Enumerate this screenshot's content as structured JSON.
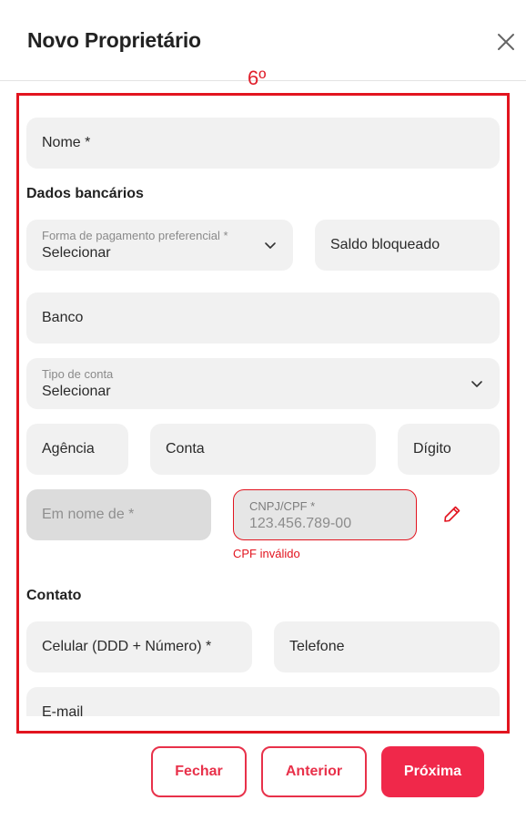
{
  "header": {
    "title": "Novo Proprietário"
  },
  "step": {
    "label": "6º"
  },
  "form": {
    "nome": {
      "placeholder": "Nome *"
    },
    "dados_bancarios": {
      "heading": "Dados bancários",
      "forma_pagamento": {
        "label": "Forma de pagamento preferencial *",
        "value": "Selecionar"
      },
      "saldo_bloqueado": {
        "placeholder": "Saldo bloqueado"
      },
      "banco": {
        "placeholder": "Banco"
      },
      "tipo_conta": {
        "label": "Tipo de conta",
        "value": "Selecionar"
      },
      "agencia": {
        "placeholder": "Agência"
      },
      "conta": {
        "placeholder": "Conta"
      },
      "digito": {
        "placeholder": "Dígito"
      },
      "em_nome_de": {
        "placeholder": "Em nome de *"
      },
      "cnpj_cpf": {
        "label": "CNPJ/CPF *",
        "value": "123.456.789-00",
        "error": "CPF inválido"
      }
    },
    "contato": {
      "heading": "Contato",
      "celular": {
        "placeholder": "Celular (DDD + Número) *"
      },
      "telefone": {
        "placeholder": "Telefone"
      },
      "email": {
        "placeholder": "E-mail"
      }
    }
  },
  "footer": {
    "fechar": "Fechar",
    "anterior": "Anterior",
    "proxima": "Próxima"
  },
  "colors": {
    "accent": "#f0284a",
    "error": "#e2141f",
    "field_bg": "#f1f1f1"
  },
  "icons": {
    "close": "close-icon",
    "chevron": "chevron-down-icon",
    "edit": "pencil-icon"
  }
}
